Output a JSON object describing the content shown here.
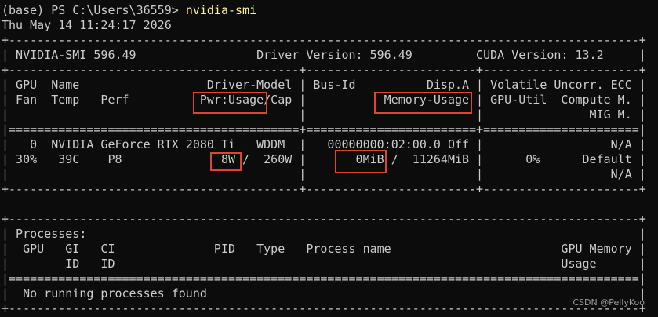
{
  "prompt": {
    "text": "(base) PS C:\\Users\\36559> ",
    "command": "nvidia-smi"
  },
  "timestamp": "Thu May 14 11:24:17 2026",
  "smi_lines": [
    "+-----------------------------------------------------------------------------------------+",
    "| NVIDIA-SMI 596.49                 Driver Version: 596.49         CUDA Version: 13.2     |",
    "+-----------------------------------------+------------------------+----------------------+",
    "| GPU  Name                  Driver-Model | Bus-Id          Disp.A | Volatile Uncorr. ECC |",
    "| Fan  Temp   Perf          Pwr:Usage/Cap |           Memory-Usage | GPU-Util  Compute M. |",
    "|                                         |                        |               MIG M. |",
    "|=========================================+========================+======================|",
    "|   0  NVIDIA GeForce RTX 2080 Ti   WDDM  |   00000000:02:00.0 Off |                  N/A |",
    "| 30%   39C    P8              8W /  260W |       0MiB /  11264MiB |      0%      Default |",
    "|                                         |                        |                  N/A |",
    "+-----------------------------------------+------------------------+----------------------+",
    "",
    "+-----------------------------------------------------------------------------------------+",
    "| Processes:                                                                              |",
    "|  GPU   GI   CI              PID   Type   Process name                        GPU Memory |",
    "|        ID   ID                                                               Usage      |",
    "|=========================================================================================|",
    "|  No running processes found                                                             |",
    "+-----------------------------------------------------------------------------------------+"
  ],
  "highlights": [
    "Pwr:Usage/Cap",
    "Memory-Usage",
    "8W",
    "0MiB"
  ],
  "watermark": "CSDN @PellyKoo",
  "colors": {
    "background": "#0c0c0c",
    "text": "#cccccc",
    "command": "#f9f1a5",
    "highlight_box": "#e0452f"
  }
}
